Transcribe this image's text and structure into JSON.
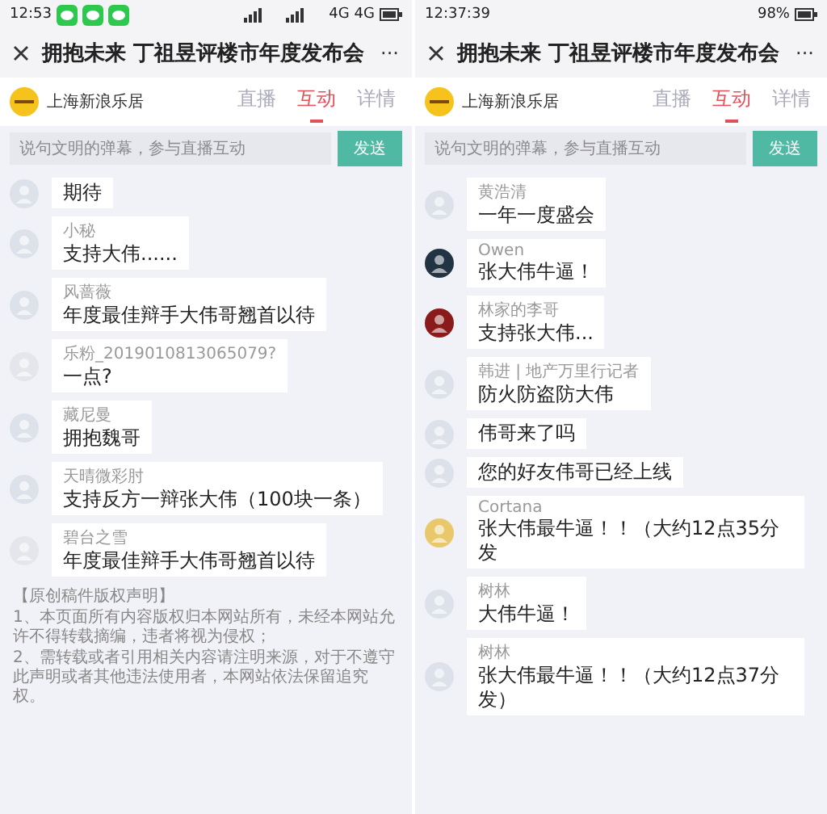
{
  "phones": [
    {
      "status_bar": {
        "time": "12:53",
        "network": [
          "4G",
          "4G"
        ]
      },
      "title": "拥抱未来 丁祖昱评楼市年度发布会",
      "more": "···",
      "channel": {
        "name": "上海新浪乐居"
      },
      "tabs": [
        {
          "label": "直播",
          "selected": false
        },
        {
          "label": "互动",
          "selected": true
        },
        {
          "label": "详情",
          "selected": false
        }
      ],
      "composer": {
        "placeholder": "说句文明的弹幕，参与直播互动",
        "send": "发送"
      },
      "messages": [
        {
          "text": "期待",
          "color": "#dde2ea"
        },
        {
          "name": "小秘",
          "text": "支持大伟......",
          "color": "#dde2ea"
        },
        {
          "name": "风蔷薇",
          "text": "年度最佳辩手大伟哥翘首以待",
          "color": "#dde2ea"
        },
        {
          "name": "乐粉_2019010813065079?",
          "text": "一点?",
          "color": "#e4e6ec"
        },
        {
          "name": "藏尼曼",
          "text": "拥抱魏哥",
          "color": "#dde2ea"
        },
        {
          "name": "天晴微彩肘",
          "text": "支持反方一辩张大伟（100块一条）",
          "color": "#dde2ea"
        },
        {
          "name": "碧台之雪",
          "text": "年度最佳辩手大伟哥翘首以待",
          "color": "#e4e6ec"
        }
      ],
      "notice": [
        "【原创稿件版权声明】",
        "1、本页面所有内容版权归本网站所有，未经本网站允许不得转载摘编，违者将视为侵权；",
        "2、需转载或者引用相关内容请注明来源，对于不遵守此声明或者其他违法使用者，本网站依法保留追究权。"
      ]
    },
    {
      "status_bar": {
        "time": "12:37:39",
        "battery": "98%"
      },
      "title": "拥抱未来 丁祖昱评楼市年度发布会",
      "more": "···",
      "channel": {
        "name": "上海新浪乐居"
      },
      "tabs": [
        {
          "label": "直播",
          "selected": false
        },
        {
          "label": "互动",
          "selected": true
        },
        {
          "label": "详情",
          "selected": false
        }
      ],
      "composer": {
        "placeholder": "说句文明的弹幕，参与直播互动",
        "send": "发送"
      },
      "messages": [
        {
          "name": "黄浩清",
          "text": "一年一度盛会",
          "color": "#dde2ea"
        },
        {
          "name": "Owen",
          "text": "张大伟牛逼！",
          "color": "#223344"
        },
        {
          "name": "林家的李哥",
          "text": "支持张大伟...",
          "color": "#8b1a1a"
        },
        {
          "name": "韩进 | 地产万里行记者",
          "text": "防火防盗防大伟",
          "color": "#dde2ea"
        },
        {
          "text": "伟哥来了吗",
          "color": "#dde2ea"
        },
        {
          "text": "您的好友伟哥已经上线",
          "color": "#dde2ea"
        },
        {
          "name": "Cortana",
          "text": "张大伟最牛逼！！（大约12点35分发",
          "color": "#e8c86a"
        },
        {
          "name": "树林",
          "text": "大伟牛逼！",
          "color": "#dde2ea"
        },
        {
          "name": "树林",
          "text": "张大伟最牛逼！！（大约12点37分发）",
          "color": "#dde2ea"
        }
      ]
    }
  ]
}
